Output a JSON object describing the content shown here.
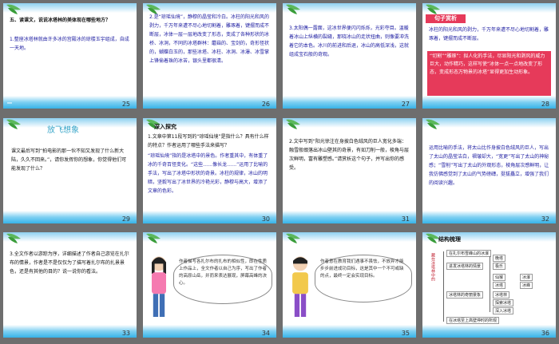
{
  "slides": [
    {
      "num": "25",
      "heading": "五、读课文，说说冰塔林的美体现在哪些地方？",
      "body": "1.整座冰塔林就由许多冰的宫殿冰的琼楼玉宇组成，自成一天地。"
    },
    {
      "num": "26",
      "body": "2.是“琼瑶仙境”，静穆的晶莹和冷白。冰柱的阳光和风的剥力，千万年来遭不尽心地切割着，雕琢着，键摆而成不断层，冰体一层一层地改变了形态，变成了各种形状的冰桥、冰洞，不同的冰塔群林：蘑菇的、宝剑的，奇形怪状的，蝴蝶白玉的，那些冰塔、冰柱、冰洞、冰瀑、冰雪掌上锋偷着珠的冰苦，银头里都很清。"
    },
    {
      "num": "27",
      "body": "3.太阳偶一露面，这冰世界便闪闪烁烁，光彩夺目。温暖着冰山上纵横的裂缝，那晓冰山的走状扭曲，则像要冲洗着它的本色。冰川的前进和后退，冰山的高低深浅，这就组成宝石般的奇观。"
    },
    {
      "num": "28",
      "banner": "句子赏析",
      "body1": "冰柱的阳光和风的剥力，千万年来遭不尽心地切割着，雕琢着，键摆而成不断层。",
      "body2": "“切割”“雕琢”：拟人化的手法，尽显阳光和剥风的威力巨大，动作精巧，这样写使“冰体一点一点地改变了形态，变成形态万物景的冰塔”显得更加生动形象。"
    },
    {
      "num": "29",
      "title": "放飞想象",
      "body": "课文最后写到“拍电影的那一伙不知又发现了什么新大陆，久久不回来。”，请你发挥你的想象，你觉得他们可能发现了什么？"
    },
    {
      "num": "30",
      "section": "深入探究",
      "q": "1.文章中第11段写到的“琼瑶仙境”是指什么？具有什么样的特点？作者运用了哪些手法来描写？",
      "a": "“琼瑶仙境”指的是冰塔中的景色。作者重其中，有体重了冰的千奇百怪变化。“这些……像长龙……”运用了比喻的手法，写出了冰塔中形状的奇景。冰柱的规律，冰山的明暗，坚毅写出了冰世界的冷艳光彩，静穆与高大，增添了文章的色彩。"
    },
    {
      "num": "31",
      "q": "2.文中写到“阳光徐注在身披白色绒风的巨人宽化多端：融雪般缀落出冰山壁其的奇景，有如刀削一般，棱角与层次鲜明，富有雕塑感。”请赏析这个句子，并写出你的感受。"
    },
    {
      "num": "32",
      "body": "运用比喻的手法，将太山比作身披白色绒风的巨人，写出了太山的晶莹洁白，褶皱却大，“宽更”写出了太山的神秘感；“雪削”写出了太山的外观形态，棱角层次感鲜明，让我仿佛感觉到了太山的气势磅礴，挺拔矗立，增强了我们的阅读兴趣。"
    },
    {
      "num": "33",
      "body": "3.全文作者以游踪为序，详细描述了作者自己游览在扎尔布的情景，作者是不是仅仅为了描写着扎尔布的扎景景色，还是有其他的目的？说一说你的看法。"
    },
    {
      "num": "34",
      "speech": "作者描写各扎尔布的扎布的相似性，即在性质上作品上，全文作者以自己为序，写出了作者的高原山岳，并而来表达展现，屏幕高峰的决心。"
    },
    {
      "num": "35",
      "speech": "作者意在教育我们遇事不畏怯，不放弃才能步步前进成功目标，这是其中一个不可或缺的点，最终一定会实现目标。"
    },
    {
      "num": "36",
      "section": "结构梳理",
      "vertical": "藏在冰塔林中的"
    },
    {
      "num": "",
      "note": ""
    }
  ],
  "outline": {
    "items": [
      "在扎尔布雪峰山的冰瀑",
      "进发冰塔林的情景",
      "冰塔林的奇丽景象",
      "在冰塔至上高壁停时的所观"
    ],
    "sub": [
      "晚塔",
      "极乐",
      "仙猴",
      "冰瀑",
      "冰塔",
      "冰峰",
      "冰山",
      "冰池",
      "冰瀑",
      "冰塔林",
      "冰河",
      "滴冰",
      "探索冰塔",
      "深入冰塔"
    ]
  }
}
